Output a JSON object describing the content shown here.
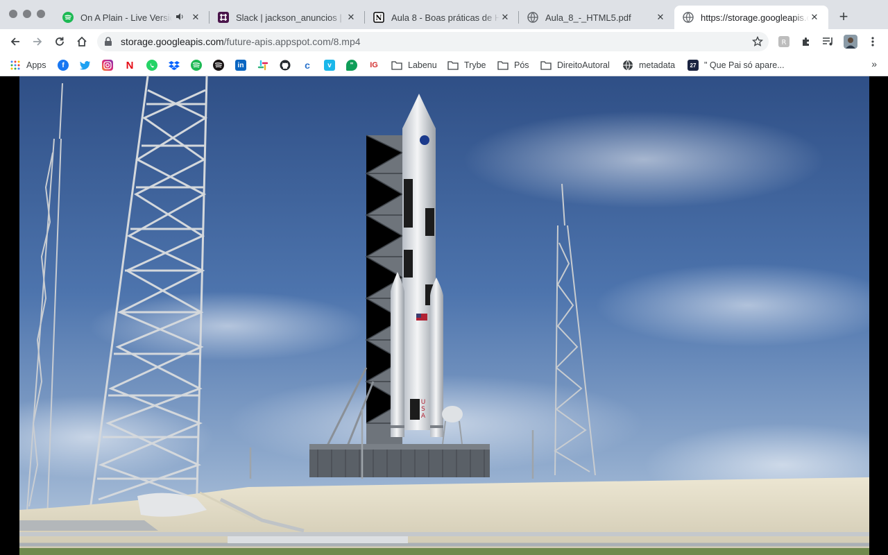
{
  "tabs": [
    {
      "title": "On A Plain - Live Version",
      "icon": "spotify-icon",
      "audio": true
    },
    {
      "title": "Slack | jackson_anuncios | L",
      "icon": "slack-icon"
    },
    {
      "title": "Aula 8 - Boas práticas de HT",
      "icon": "notion-icon"
    },
    {
      "title": "Aula_8_-_HTML5.pdf",
      "icon": "globe-icon"
    },
    {
      "title": "https://storage.googleapis.c",
      "icon": "globe-icon",
      "active": true
    }
  ],
  "omnibox": {
    "host": "storage.googleapis.com",
    "path": "/future-apis.appspot.com/8.mp4"
  },
  "bookmarks": {
    "apps_label": "Apps",
    "folders": [
      "Labenu",
      "Trybe",
      "Pós",
      "DireitoAutoral"
    ],
    "metadata_label": "metadata",
    "last_label": "\" Que Pai só apare..."
  },
  "colors": {
    "tabstrip": "#dee1e6",
    "omnibox": "#f1f3f4",
    "sky": "#3a5f9e"
  }
}
